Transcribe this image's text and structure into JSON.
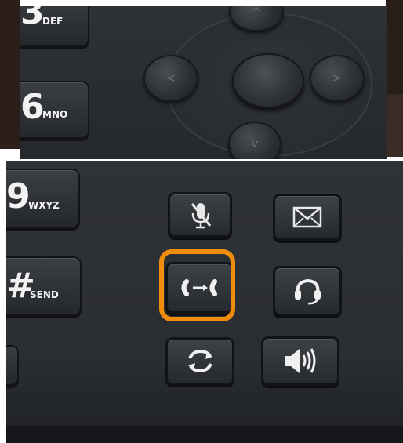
{
  "keypad": {
    "key_3": {
      "digit": "3",
      "letters": "DEF"
    },
    "key_6": {
      "digit": "6",
      "letters": "MNO"
    },
    "key_9": {
      "digit": "9",
      "letters": "WXYZ"
    },
    "key_hash": {
      "digit": "#",
      "letters": "SEND"
    }
  },
  "navigation": {
    "left": "<",
    "right": ">",
    "down": "v",
    "up": "^"
  },
  "function_buttons": [
    "mute",
    "message",
    "transfer",
    "headset",
    "redial",
    "speaker"
  ],
  "highlight": {
    "color": "#f08c0c",
    "target": "transfer"
  }
}
